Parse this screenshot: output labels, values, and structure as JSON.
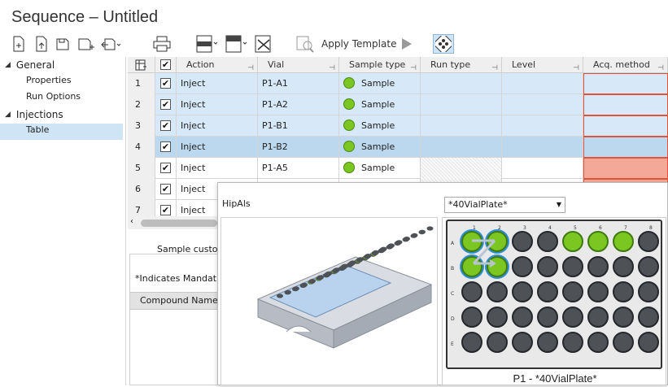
{
  "window": {
    "title": "Sequence – Untitled"
  },
  "toolbar": {
    "apply_template_label": "Apply Template"
  },
  "nav": {
    "groups": [
      {
        "label": "General",
        "items": [
          "Properties",
          "Run Options"
        ]
      },
      {
        "label": "Injections",
        "items": [
          "Table"
        ]
      }
    ],
    "selected": "Table"
  },
  "table": {
    "columns": [
      "Action",
      "Vial",
      "Sample type",
      "Run type",
      "Level",
      "Acq. method"
    ],
    "rows": [
      {
        "num": "1",
        "checked": true,
        "action": "Inject",
        "vial": "P1-A1",
        "sample_type": "Sample",
        "state": "selected"
      },
      {
        "num": "2",
        "checked": true,
        "action": "Inject",
        "vial": "P1-A2",
        "sample_type": "Sample",
        "state": "selected"
      },
      {
        "num": "3",
        "checked": true,
        "action": "Inject",
        "vial": "P1-B1",
        "sample_type": "Sample",
        "state": "selected"
      },
      {
        "num": "4",
        "checked": true,
        "action": "Inject",
        "vial": "P1-B2",
        "sample_type": "Sample",
        "state": "focused"
      },
      {
        "num": "5",
        "checked": true,
        "action": "Inject",
        "vial": "P1-A5",
        "sample_type": "Sample",
        "state": "normal"
      },
      {
        "num": "6",
        "checked": true,
        "action": "Inject",
        "vial": "",
        "sample_type": "",
        "state": "normal"
      },
      {
        "num": "7",
        "checked": true,
        "action": "Inject",
        "vial": "",
        "sample_type": "",
        "state": "normal"
      }
    ]
  },
  "lower_panel": {
    "tab_label": "Sample custo",
    "mandatory_note": "*Indicates Mandat",
    "compound_header": "Compound Name"
  },
  "popup": {
    "label": "HipAls",
    "plate_dropdown_value": "*40VialPlate*",
    "plate_caption": "P1 - *40VialPlate*",
    "plate": {
      "columns": [
        "1",
        "2",
        "3",
        "4",
        "5",
        "6",
        "7",
        "8"
      ],
      "rows": [
        "A",
        "B",
        "C",
        "D",
        "E"
      ],
      "green_wells": [
        "A1",
        "A2",
        "A5",
        "A6",
        "A7",
        "B1",
        "B2"
      ],
      "selected_wells": [
        "A1",
        "A2",
        "B1",
        "B2"
      ]
    }
  },
  "colors": {
    "sample_dot": "#7bc621",
    "selection": "#cfe5f6",
    "error_cell": "#f4a898"
  }
}
